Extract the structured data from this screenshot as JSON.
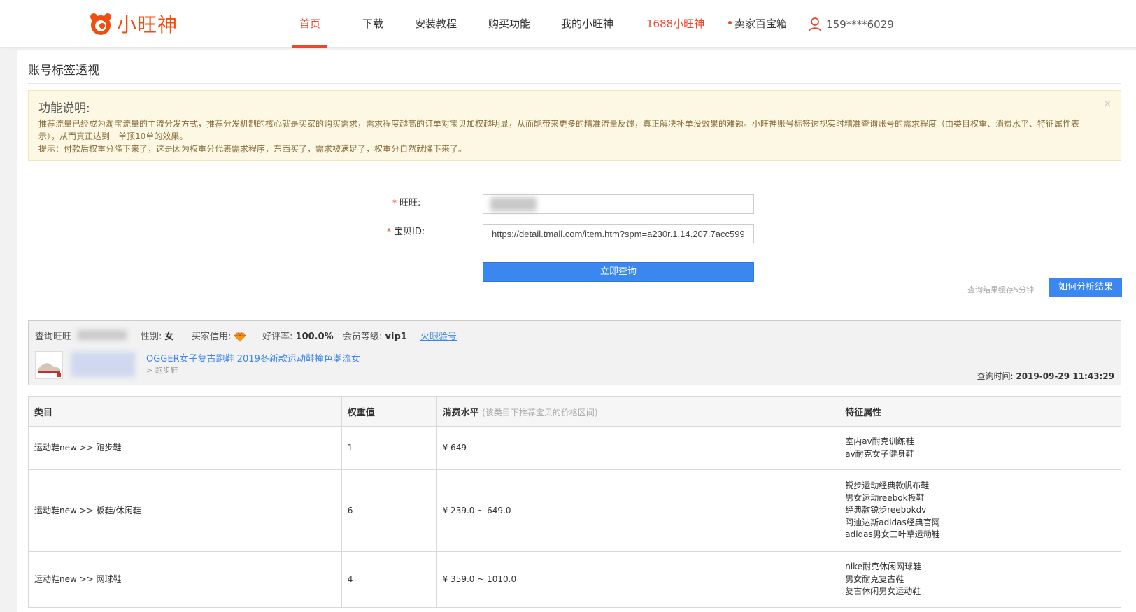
{
  "brand": {
    "name": "小旺神",
    "color": "#f04e0e"
  },
  "nav": [
    {
      "label": "首页",
      "active": true
    },
    {
      "label": "下载"
    },
    {
      "label": "安装教程"
    },
    {
      "label": "购买功能"
    },
    {
      "label": "我的小旺神"
    },
    {
      "label": "1688小旺神",
      "highlight": true
    },
    {
      "label": "卖家百宝箱",
      "dot": true
    }
  ],
  "user": {
    "icon": "user-icon",
    "account": "159****6029"
  },
  "page": {
    "title": "账号标签透视"
  },
  "notice": {
    "title": "功能说明:",
    "close": "×",
    "line1": "推荐流量已经成为淘宝流量的主流分发方式，推荐分发机制的核心就是买家的购买需求，需求程度越高的订单对宝贝加权越明显，从而能带来更多的精准流量反馈，真正解决补单没效果的难题。小旺神账号标签透视实时精准查询账号的需求程度（由类目权重、消费水平、特征属性表示），从而真正达到一单顶10单的效果。",
    "line2": "提示：付款后权重分降下来了，这是因为权重分代表需求程序，东西买了，需求被满足了，权重分自然就降下来了。"
  },
  "form": {
    "wangwang_label": "旺旺:",
    "itemid_label": "宝贝ID:",
    "required_mark": "*",
    "itemid_value": "https://detail.tmall.com/item.htm?spm=a230r.1.14.207.7acc599",
    "submit_label": "立即查询"
  },
  "result_bar": {
    "cache_note": "查询结果缓存5分钟",
    "analyze_label": "如何分析结果"
  },
  "result": {
    "wangwang_label": "查询旺旺",
    "gender_label": "性别:",
    "gender": "女",
    "credit_label": "买家信用:",
    "credit_icon": "diamond-icon",
    "praise_label": "好评率:",
    "praise": "100.0%",
    "member_label": "会员等级:",
    "member": "vip1",
    "link_label": "火眼验号",
    "item_title": "OGGER女子复古跑鞋 2019冬新款运动鞋撞色潮流女",
    "item_cat": "> 跑步鞋",
    "query_time_label": "查询时间:",
    "query_time": "2019-09-29 11:43:29"
  },
  "table": {
    "headers": {
      "category": "类目",
      "weight": "权重值",
      "spend": "消费水平",
      "spend_note": "(该类目下推荐宝贝的价格区间)",
      "features": "特征属性"
    },
    "rows": [
      {
        "category": "运动鞋new >> 跑步鞋",
        "highlight": true,
        "weight": "1",
        "spend": "¥ 649",
        "features": [
          "室内av耐克训练鞋",
          "av耐克女子健身鞋"
        ]
      },
      {
        "category": "运动鞋new >> 板鞋/休闲鞋",
        "weight": "6",
        "spend": "¥ 239.0 ~ 649.0",
        "features": [
          "锐步运动经典款帆布鞋",
          "男女运动reebok板鞋",
          "经典款锐步reebokdv",
          "阿迪达斯adidas经典官网",
          "adidas男女三叶草运动鞋"
        ]
      },
      {
        "category": "运动鞋new >> 网球鞋",
        "weight": "4",
        "spend": "¥ 359.0 ~ 1010.0",
        "features": [
          "nike耐克休闲网球鞋",
          "男女耐克复古鞋",
          "复古休闲男女运动鞋"
        ]
      }
    ]
  }
}
